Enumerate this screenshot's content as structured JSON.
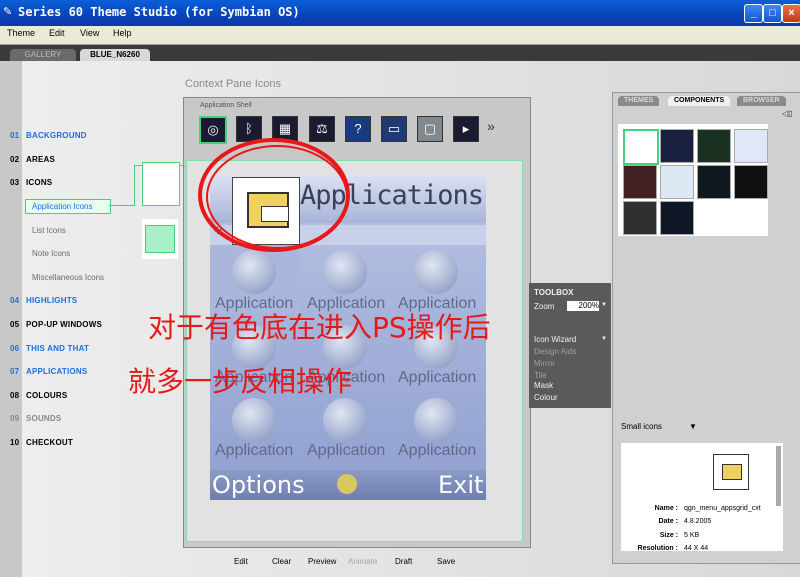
{
  "window": {
    "title": "Series 60 Theme Studio (for Symbian OS)"
  },
  "menu": [
    "Theme",
    "Edit",
    "View",
    "Help"
  ],
  "tabs": {
    "gallery": "GALLERY",
    "current": "BLUE_N6260"
  },
  "nav": [
    {
      "num": "01",
      "label": "BACKGROUND",
      "style": "blue"
    },
    {
      "num": "02",
      "label": "AREAS",
      "style": "normal"
    },
    {
      "num": "03",
      "label": "ICONS",
      "style": "normal"
    },
    {
      "num": "04",
      "label": "HIGHLIGHTS",
      "style": "blue"
    },
    {
      "num": "05",
      "label": "POP-UP WINDOWS",
      "style": "normal"
    },
    {
      "num": "06",
      "label": "THIS AND THAT",
      "style": "blue"
    },
    {
      "num": "07",
      "label": "APPLICATIONS",
      "style": "blue"
    },
    {
      "num": "08",
      "label": "COLOURS",
      "style": "normal"
    },
    {
      "num": "09",
      "label": "SOUNDS",
      "style": "gray"
    },
    {
      "num": "10",
      "label": "CHECKOUT",
      "style": "normal"
    }
  ],
  "icons_sub": [
    "Application Icons",
    "List Icons",
    "Note Icons",
    "Miscellaneous Icons"
  ],
  "context_pane_title": "Context Pane Icons",
  "app_shell_label": "Application Shell",
  "more_arrow": "»",
  "screen": {
    "title": "Applications",
    "cell_label": "Application",
    "softkey_left": "Options",
    "softkey_right": "Exit"
  },
  "overlay": {
    "line1": "对于有色底在进入PS操作后",
    "line2": "就多一步反相操作"
  },
  "right_tabs": {
    "themes": "THEMES",
    "components": "COMPONENTS",
    "browser": "BROWSER"
  },
  "toolbox": {
    "title": "TOOLBOX",
    "zoom_label": "Zoom",
    "zoom_value": "200%",
    "items": [
      "Icon Wizard",
      "Design Aids",
      "Mirror",
      "Tile",
      "Mask",
      "Colour"
    ],
    "dim_items": [
      "Design Aids",
      "Mirror",
      "Tile"
    ]
  },
  "small_icons_label": "Small icons",
  "file_info": {
    "name_label": "Name :",
    "name": "qgn_menu_appsgrid_cxt",
    "date_label": "Date :",
    "date": "4.8.2005",
    "size_label": "Size :",
    "size": "5 KB",
    "res_label": "Resolution :",
    "res": "44 X 44"
  },
  "bottom_buttons": [
    "Edit",
    "Clear",
    "Preview",
    "Animate",
    "Draft",
    "Save"
  ],
  "colors": {
    "accent_blue": "#1a6ee0",
    "annotation_red": "#e81818",
    "selection_green": "#46d27a"
  }
}
